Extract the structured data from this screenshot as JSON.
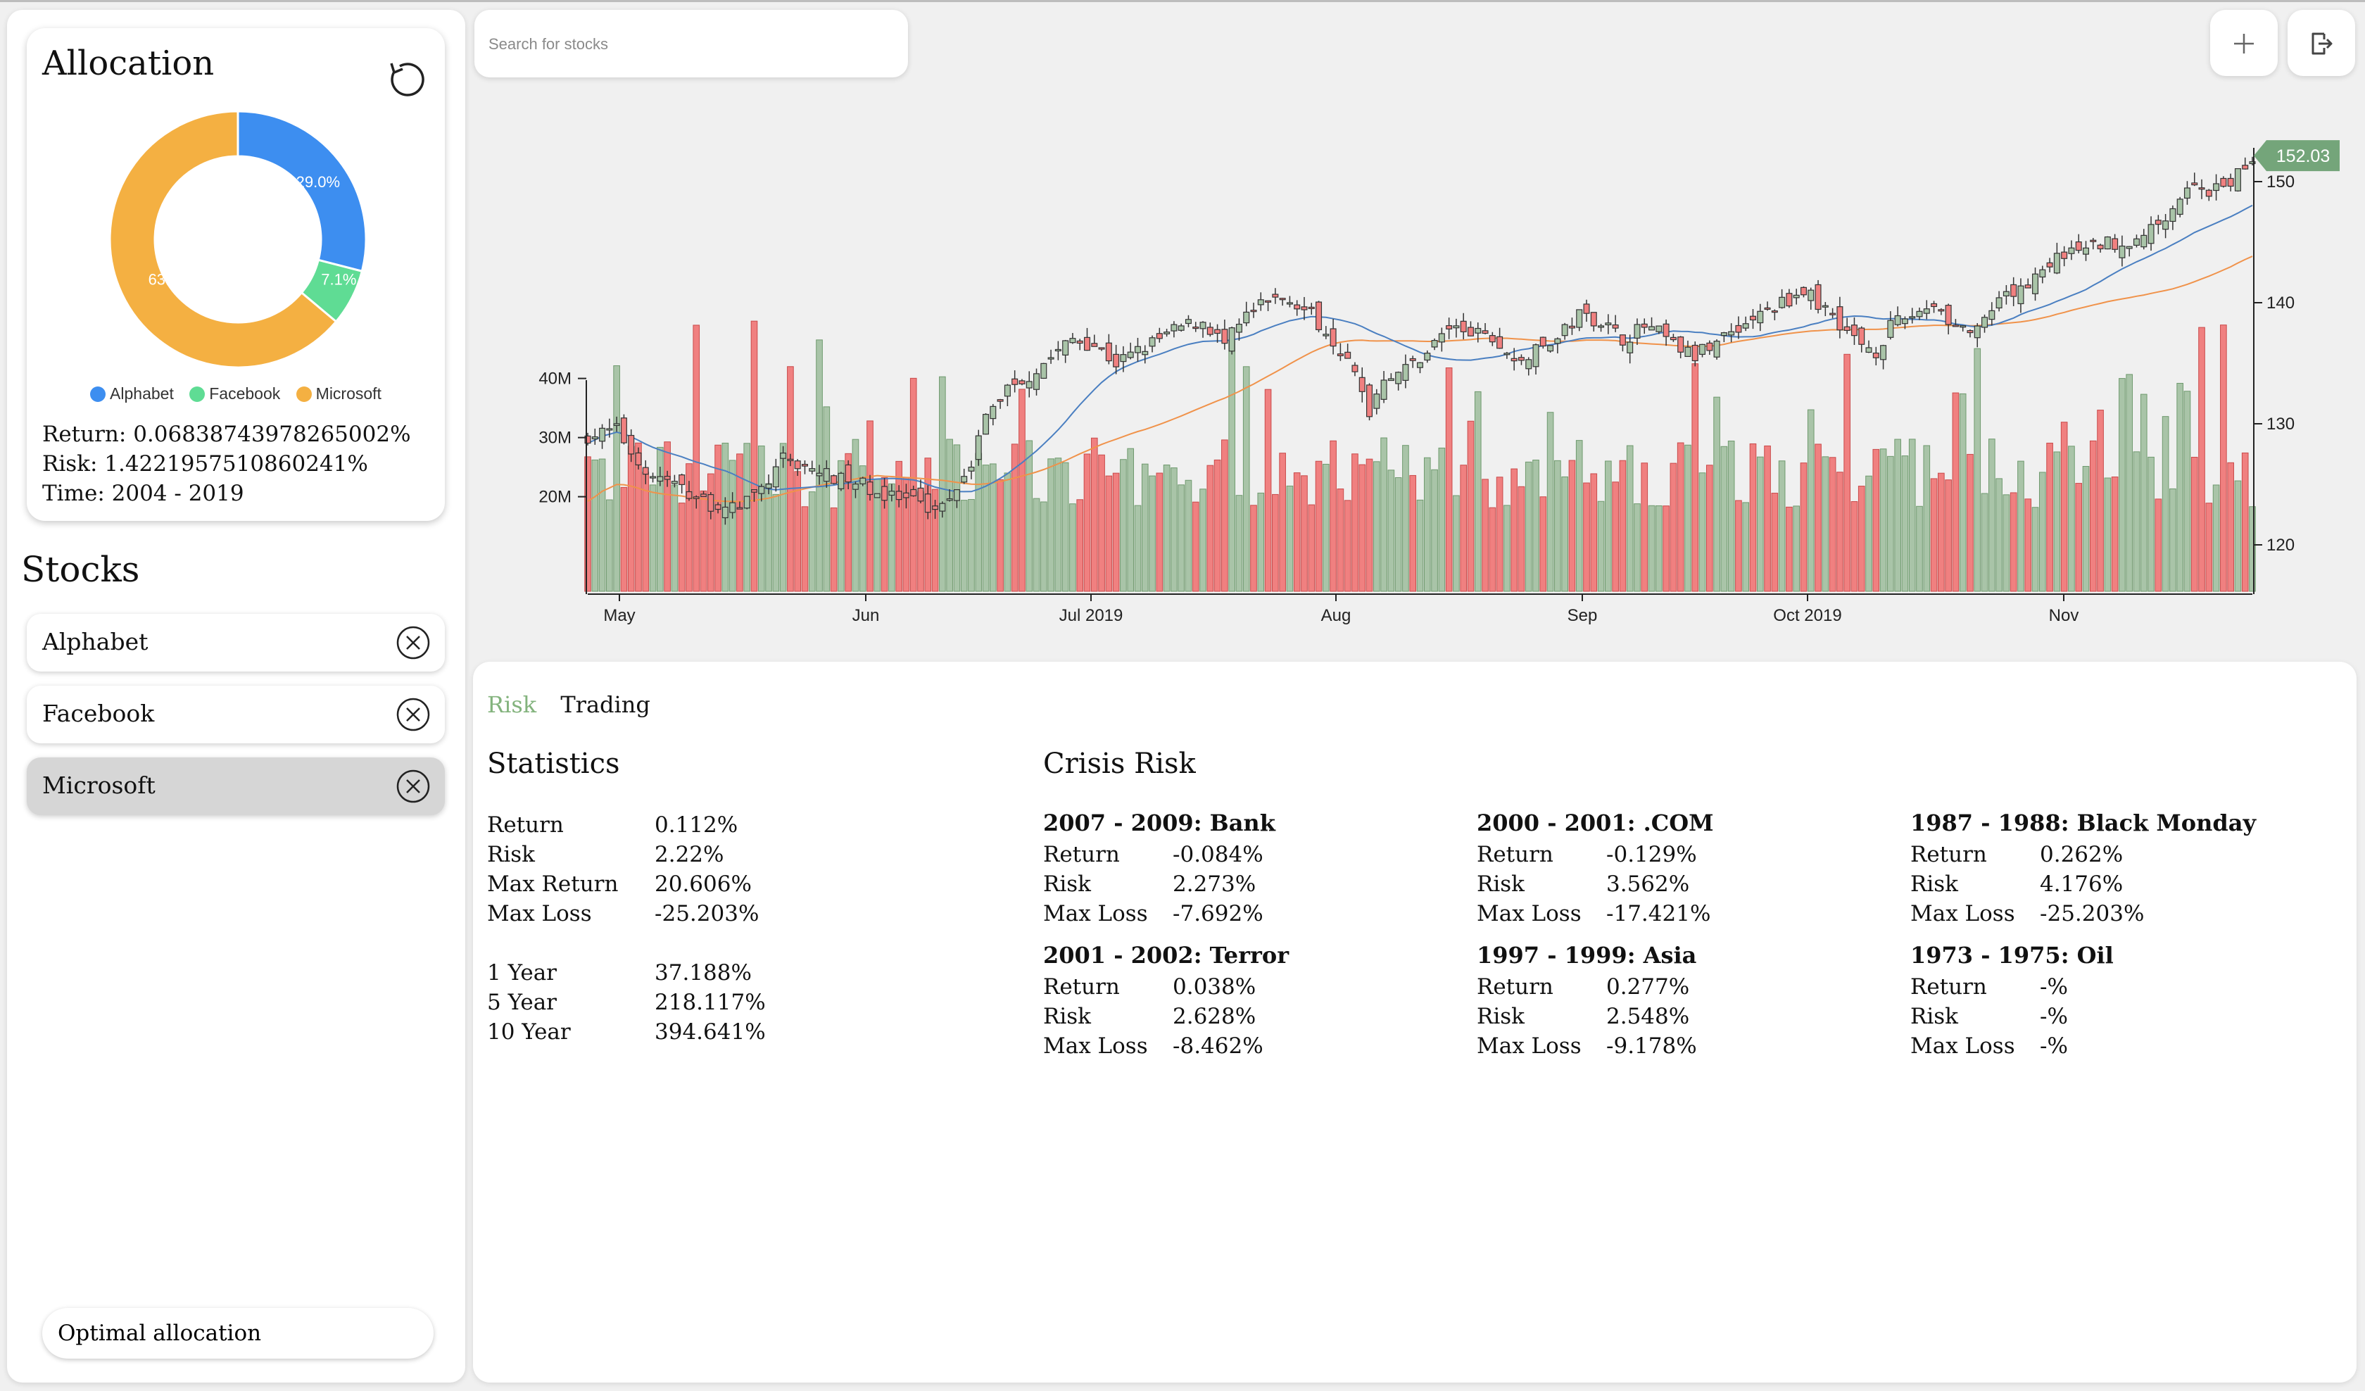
{
  "allocation": {
    "title": "Allocation",
    "slices": [
      {
        "name": "Alphabet",
        "percent": 29.0,
        "label": "29.0%",
        "color": "#3d8ef0"
      },
      {
        "name": "Facebook",
        "percent": 7.1,
        "label": "7.1%",
        "color": "#5fdc94"
      },
      {
        "name": "Microsoft",
        "percent": 63.9,
        "label": "63.9%",
        "color": "#f4b042"
      }
    ],
    "return_text": "Return: 0.06838743978265002%",
    "risk_text": "Risk: 1.4221957510860241%",
    "time_text": "Time: 2004 - 2019"
  },
  "stocks": {
    "title": "Stocks",
    "items": [
      {
        "name": "Alphabet",
        "selected": false
      },
      {
        "name": "Facebook",
        "selected": false
      },
      {
        "name": "Microsoft",
        "selected": true
      }
    ]
  },
  "optimal_label": "Optimal allocation",
  "search": {
    "placeholder": "Search for stocks",
    "value": ""
  },
  "toolbar": {
    "add_icon": "plus-icon",
    "logout_icon": "logout-icon"
  },
  "chart_data": {
    "type": "candlestick",
    "last_price": 152.03,
    "last_price_label": "152.03",
    "price_axis": {
      "ticks": [
        "120",
        "130",
        "140",
        "150"
      ],
      "range": [
        115,
        155
      ]
    },
    "volume_axis": {
      "ticks": [
        "20M",
        "30M",
        "40M"
      ]
    },
    "x_ticks": [
      "May",
      "Jun",
      "Jul 2019",
      "Aug",
      "Sep",
      "Oct 2019",
      "Nov"
    ],
    "colors": {
      "up": "#a9c4a8",
      "down": "#f08080",
      "ma_short": "#4a7fc1",
      "ma_long": "#f0924a",
      "price_tag": "#74a57a"
    }
  },
  "tabs": [
    {
      "label": "Risk",
      "active": true
    },
    {
      "label": "Trading",
      "active": false
    }
  ],
  "statistics": {
    "title": "Statistics",
    "rows": [
      {
        "label": "Return",
        "value": "0.112%"
      },
      {
        "label": "Risk",
        "value": "2.22%"
      },
      {
        "label": "Max Return",
        "value": "20.606%"
      },
      {
        "label": "Max Loss",
        "value": "-25.203%"
      }
    ],
    "periods": [
      {
        "label": "1 Year",
        "value": "37.188%"
      },
      {
        "label": "5 Year",
        "value": "218.117%"
      },
      {
        "label": "10 Year",
        "value": "394.641%"
      }
    ]
  },
  "crisis": {
    "title": "Crisis Risk",
    "items": [
      {
        "title": "2007 - 2009: Bank",
        "return": "-0.084%",
        "risk": "2.273%",
        "max_loss": "-7.692%"
      },
      {
        "title": "2000 - 2001: .COM",
        "return": "-0.129%",
        "risk": "3.562%",
        "max_loss": "-17.421%"
      },
      {
        "title": "1987 - 1988: Black Monday",
        "return": "0.262%",
        "risk": "4.176%",
        "max_loss": "-25.203%"
      },
      {
        "title": "2001 - 2002: Terror",
        "return": "0.038%",
        "risk": "2.628%",
        "max_loss": "-8.462%"
      },
      {
        "title": "1997 - 1999: Asia",
        "return": "0.277%",
        "risk": "2.548%",
        "max_loss": "-9.178%"
      },
      {
        "title": "1973 - 1975: Oil",
        "return": "-%",
        "risk": "-%",
        "max_loss": "-%"
      }
    ],
    "labels": {
      "return": "Return",
      "risk": "Risk",
      "max_loss": "Max Loss"
    }
  }
}
